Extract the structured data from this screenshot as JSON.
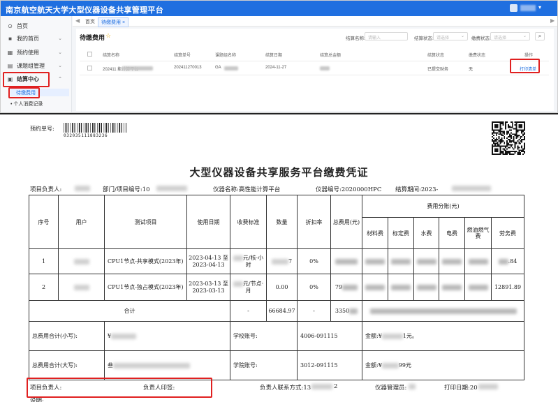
{
  "app": {
    "title": "南京航空航天大学大型仪器设备共享管理平台",
    "user_caret": "▾"
  },
  "sidebar": {
    "items": [
      {
        "label": "首页",
        "icon": "home-icon",
        "glyph": "⊙",
        "arrow": ""
      },
      {
        "label": "我的首页",
        "icon": "dashboard-icon",
        "glyph": "■",
        "arrow": "⌄"
      },
      {
        "label": "预约使用",
        "icon": "calendar-icon",
        "glyph": "▦",
        "arrow": "⌄"
      },
      {
        "label": "课题组管理",
        "icon": "group-icon",
        "glyph": "▤",
        "arrow": "⌄"
      },
      {
        "label": "结算中心",
        "icon": "settlement-icon",
        "glyph": "▣",
        "arrow": "⌃"
      }
    ],
    "subitems": [
      {
        "label": "待缴费用"
      },
      {
        "label": "个人消费记录"
      }
    ]
  },
  "tabs": {
    "home": "首页",
    "active": "待缴费用",
    "close": "×",
    "left_nav": "◀",
    "right_nav": "▶"
  },
  "page": {
    "title": "待缴费用",
    "star": "☆"
  },
  "filters": {
    "name_label": "结算名称:",
    "name_placeholder": "请输入",
    "status_label": "结算状态:",
    "status_value": "请选择",
    "fee_label": "缴费状态:",
    "fee_value": "请选择",
    "search_icon": "search-icon",
    "search_glyph": "⌕"
  },
  "table": {
    "headers": [
      "结算名称",
      "结算单号",
      "课题组名称",
      "结算日期",
      "结算总金额",
      "结算状态",
      "缴费状态",
      "操作"
    ],
    "rows": [
      {
        "name": "202411 能计算平台",
        "number": "202411270013",
        "group": "GA",
        "date": "2024-11-27",
        "amount": "",
        "status": "已提交财务",
        "fee_status": "无",
        "action": "打印清单"
      }
    ]
  },
  "receipt": {
    "appointment_label": "预约单号:",
    "barcode_number": "032035111883236",
    "title": "大型仪器设备共享服务平台缴费凭证",
    "header_fields": {
      "pi_label": "项目负责人:",
      "dept_label": "部门/项目编号:10",
      "instrument_name": "仪器名称:高性能计算平台",
      "instrument_no": "仪器编号:2020000HPC",
      "period": "结算期间:2023-"
    },
    "columns": {
      "seq": "序号",
      "user": "用户",
      "item": "测试项目",
      "date": "使用日期",
      "standard": "收费标准",
      "qty": "数量",
      "discount": "折扣率",
      "total": "总费用(元)",
      "split": "费用分账(元)",
      "materials": "材料费",
      "calibration": "标定费",
      "water": "水费",
      "electricity": "电费",
      "gas": "燃油燃气费",
      "labor": "劳务费"
    },
    "rows": [
      {
        "seq": "1",
        "item": "CPU1节点-共享模式(2023年)",
        "date": "2023-04-13 至2023-04-13",
        "standard": "元/核·小时",
        "qty": "7",
        "discount": "0%",
        "total": "",
        "labor": ".84"
      },
      {
        "seq": "2",
        "item": "CPU1节点-独占模式(2023年)",
        "date": "2023-03-13 至2023-03-13",
        "standard": "元/节点·月",
        "qty": "0.00",
        "discount": "0%",
        "total": "79",
        "labor": "12891.89"
      }
    ],
    "sum": {
      "label": "合计",
      "standard": "-",
      "qty": "66684.97",
      "discount": "-",
      "total": "3350"
    },
    "totals": {
      "small_label": "总费用合计(小写):",
      "small_value": "¥",
      "school_account_label": "学校账号:",
      "school_account": "4006-091115",
      "amount_label1": "金额:¥",
      "amount_tail1": "1元。",
      "big_label": "总费用合计(大写):",
      "big_value": "叁",
      "college_account_label": "学院账号:",
      "college_account": "3012-091115",
      "amount_label2": "金额:¥",
      "amount_tail2": "99元"
    },
    "footer": {
      "pi_label": "项目负责人:",
      "pi_sign": "负责人印签:",
      "phone_label": "负责人联系方式:13",
      "phone_tail": "2",
      "manager_label": "仪器管理员:",
      "print_date": "打印日期:20",
      "note": "说明:"
    }
  }
}
